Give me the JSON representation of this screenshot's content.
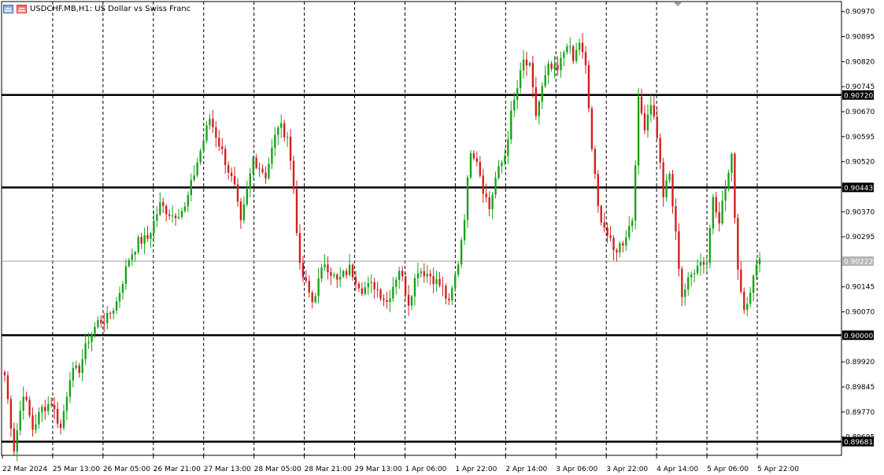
{
  "header": {
    "symbol": "USDCHF.MB",
    "timeframe": "H1",
    "description": "US Dollar vs Swiss Franc",
    "title_text": "USDCHF.MB,H1:  US Dollar vs Swiss Franc",
    "icon_names": [
      "chart-list-icon",
      "chart-bars-icon"
    ]
  },
  "colors": {
    "bull": "#16a316",
    "bear": "#d21e1e",
    "grid": "#000000",
    "level_line": "#000000",
    "current_price_line": "#a0a0a0",
    "current_price_label_bg": "#b4b4b4"
  },
  "chart_data": {
    "type": "candlestick",
    "title": "USDCHF.MB,H1:  US Dollar vs Swiss Franc",
    "ylim": [
      0.8964,
      0.91
    ],
    "grid": true,
    "y_ticks": [
      "0.90970",
      "0.90895",
      "0.90820",
      "0.90745",
      "0.90670",
      "0.90595",
      "0.90520",
      "0.90370",
      "0.90295",
      "0.90145",
      "0.90070",
      "0.89920",
      "0.89845",
      "0.89770",
      "0.89695"
    ],
    "x_ticks": [
      "22 Mar 2024",
      "25 Mar 13:00",
      "26 Mar 05:00",
      "26 Mar 21:00",
      "27 Mar 13:00",
      "28 Mar 05:00",
      "28 Mar 21:00",
      "29 Mar 13:00",
      "1 Apr 06:00",
      "1 Apr 22:00",
      "2 Apr 14:00",
      "3 Apr 06:00",
      "3 Apr 22:00",
      "4 Apr 14:00",
      "5 Apr 06:00",
      "5 Apr 22:00"
    ],
    "levels": [
      {
        "value": 0.9072,
        "label": "0.90720"
      },
      {
        "value": 0.90443,
        "label": "0.90443"
      },
      {
        "value": 0.9,
        "label": "0.90000"
      },
      {
        "value": 0.89681,
        "label": "0.89681"
      }
    ],
    "current_price": {
      "value": 0.90222,
      "label": "0.90222"
    },
    "waypoints": [
      [
        0,
        0.8988
      ],
      [
        3,
        0.8966
      ],
      [
        6,
        0.8983
      ],
      [
        9,
        0.8972
      ],
      [
        12,
        0.8978
      ],
      [
        15,
        0.898
      ],
      [
        18,
        0.8972
      ],
      [
        21,
        0.8988
      ],
      [
        24,
        0.899
      ],
      [
        27,
        0.8999
      ],
      [
        30,
        0.9004
      ],
      [
        33,
        0.9005
      ],
      [
        36,
        0.901
      ],
      [
        40,
        0.9023
      ],
      [
        43,
        0.9028
      ],
      [
        46,
        0.9029
      ],
      [
        50,
        0.9039
      ],
      [
        54,
        0.9036
      ],
      [
        58,
        0.9038
      ],
      [
        62,
        0.9052
      ],
      [
        66,
        0.9065
      ],
      [
        70,
        0.9055
      ],
      [
        74,
        0.9044
      ],
      [
        76,
        0.9033
      ],
      [
        80,
        0.9053
      ],
      [
        84,
        0.9048
      ],
      [
        88,
        0.9063
      ],
      [
        91,
        0.906
      ],
      [
        93,
        0.9044
      ],
      [
        95,
        0.902
      ],
      [
        99,
        0.901
      ],
      [
        103,
        0.9022
      ],
      [
        107,
        0.9016
      ],
      [
        111,
        0.902
      ],
      [
        115,
        0.9014
      ],
      [
        119,
        0.9015
      ],
      [
        123,
        0.901
      ],
      [
        127,
        0.902
      ],
      [
        130,
        0.901
      ],
      [
        133,
        0.902
      ],
      [
        137,
        0.9018
      ],
      [
        141,
        0.9014
      ],
      [
        143,
        0.9009
      ],
      [
        146,
        0.9022
      ],
      [
        148,
        0.9036
      ],
      [
        150,
        0.9056
      ],
      [
        152,
        0.9053
      ],
      [
        154,
        0.9044
      ],
      [
        156,
        0.9038
      ],
      [
        158,
        0.9047
      ],
      [
        161,
        0.9054
      ],
      [
        163,
        0.9066
      ],
      [
        165,
        0.9074
      ],
      [
        167,
        0.9082
      ],
      [
        169,
        0.908
      ],
      [
        171,
        0.9066
      ],
      [
        173,
        0.9074
      ],
      [
        175,
        0.908
      ],
      [
        178,
        0.9079
      ],
      [
        181,
        0.9088
      ],
      [
        183,
        0.9082
      ],
      [
        185,
        0.9088
      ],
      [
        187,
        0.908
      ],
      [
        189,
        0.9056
      ],
      [
        191,
        0.9038
      ],
      [
        194,
        0.903
      ],
      [
        196,
        0.9025
      ],
      [
        199,
        0.9028
      ],
      [
        202,
        0.9035
      ],
      [
        204,
        0.907
      ],
      [
        206,
        0.9063
      ],
      [
        208,
        0.907
      ],
      [
        210,
        0.906
      ],
      [
        212,
        0.9042
      ],
      [
        214,
        0.9048
      ],
      [
        216,
        0.903
      ],
      [
        218,
        0.9012
      ],
      [
        220,
        0.9016
      ],
      [
        223,
        0.9022
      ],
      [
        226,
        0.9022
      ],
      [
        228,
        0.9042
      ],
      [
        230,
        0.9035
      ],
      [
        232,
        0.9044
      ],
      [
        234,
        0.9053
      ],
      [
        236,
        0.902
      ],
      [
        238,
        0.9008
      ],
      [
        240,
        0.9014
      ],
      [
        242,
        0.902
      ],
      [
        243,
        0.9023
      ]
    ]
  }
}
